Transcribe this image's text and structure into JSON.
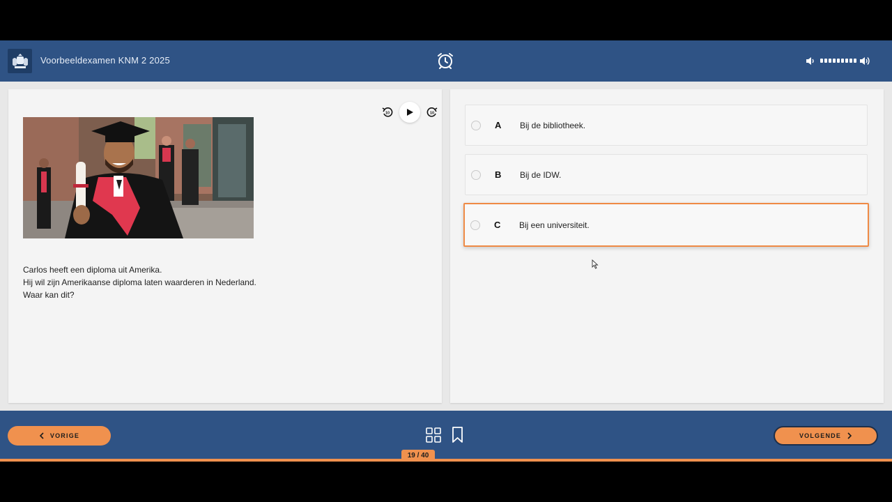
{
  "header": {
    "title": "Voorbeeldexamen KNM 2 2025",
    "logo_icon": "coat-of-arms-icon",
    "timer_icon": "alarm-clock-icon",
    "volume_down_icon": "volume-down-icon",
    "volume_up_icon": "volume-up-icon",
    "volume_level": 1.0
  },
  "media": {
    "rewind_icon": "rewind-10-icon",
    "play_icon": "play-icon",
    "forward_icon": "forward-10-icon"
  },
  "question": {
    "image_icon": "graduate-photo",
    "lines": [
      "Carlos heeft een diploma uit Amerika.",
      "Hij wil zijn Amerikaanse diploma laten waarderen in Nederland.",
      "Waar kan dit?"
    ]
  },
  "options": [
    {
      "letter": "A",
      "text": "Bij de bibliotheek.",
      "selected": false
    },
    {
      "letter": "B",
      "text": "Bij de IDW.",
      "selected": false
    },
    {
      "letter": "C",
      "text": "Bij een universiteit.",
      "selected": true
    }
  ],
  "footer": {
    "prev_label": "VORIGE",
    "next_label": "VOLGENDE",
    "page_counter": "19 / 40",
    "grid_icon": "grid-overview-icon",
    "bookmark_icon": "bookmark-icon"
  },
  "colors": {
    "primary": "#2f5385",
    "accent": "#f0914e",
    "panel": "#f4f4f4"
  }
}
